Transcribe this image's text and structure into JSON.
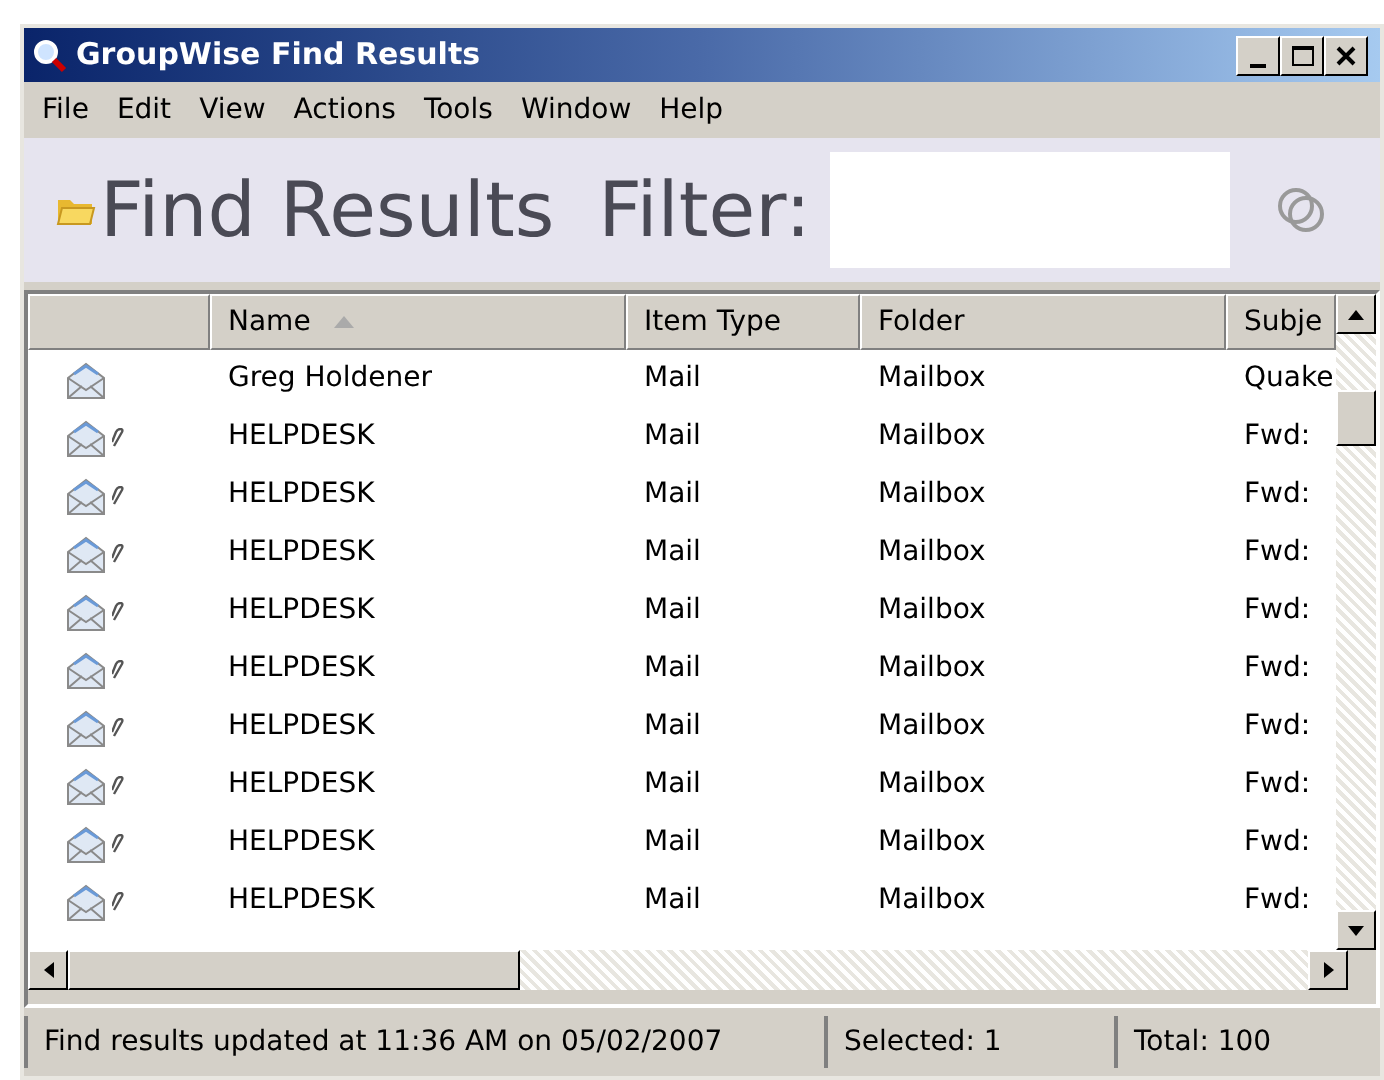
{
  "window": {
    "title": "GroupWise Find Results"
  },
  "menu": [
    "File",
    "Edit",
    "View",
    "Actions",
    "Tools",
    "Window",
    "Help"
  ],
  "header": {
    "title": "Find Results",
    "filter_label": "Filter:"
  },
  "table": {
    "columns": [
      "Name",
      "Item Type",
      "Folder",
      "Subje"
    ],
    "rows": [
      {
        "attachment": false,
        "name": "Greg Holdener",
        "item_type": "Mail",
        "folder": "Mailbox",
        "subject": "Quake"
      },
      {
        "attachment": true,
        "name": "HELPDESK",
        "item_type": "Mail",
        "folder": "Mailbox",
        "subject": "Fwd:"
      },
      {
        "attachment": true,
        "name": "HELPDESK",
        "item_type": "Mail",
        "folder": "Mailbox",
        "subject": "Fwd:"
      },
      {
        "attachment": true,
        "name": "HELPDESK",
        "item_type": "Mail",
        "folder": "Mailbox",
        "subject": "Fwd:"
      },
      {
        "attachment": true,
        "name": "HELPDESK",
        "item_type": "Mail",
        "folder": "Mailbox",
        "subject": "Fwd:"
      },
      {
        "attachment": true,
        "name": "HELPDESK",
        "item_type": "Mail",
        "folder": "Mailbox",
        "subject": "Fwd:"
      },
      {
        "attachment": true,
        "name": "HELPDESK",
        "item_type": "Mail",
        "folder": "Mailbox",
        "subject": "Fwd:"
      },
      {
        "attachment": true,
        "name": "HELPDESK",
        "item_type": "Mail",
        "folder": "Mailbox",
        "subject": "Fwd:"
      },
      {
        "attachment": true,
        "name": "HELPDESK",
        "item_type": "Mail",
        "folder": "Mailbox",
        "subject": "Fwd:"
      },
      {
        "attachment": true,
        "name": "HELPDESK",
        "item_type": "Mail",
        "folder": "Mailbox",
        "subject": "Fwd:"
      }
    ]
  },
  "status_bar": [
    "Find results updated at 11:36 AM on 05/02/2007",
    "Selected: 1",
    "Total: 100"
  ]
}
